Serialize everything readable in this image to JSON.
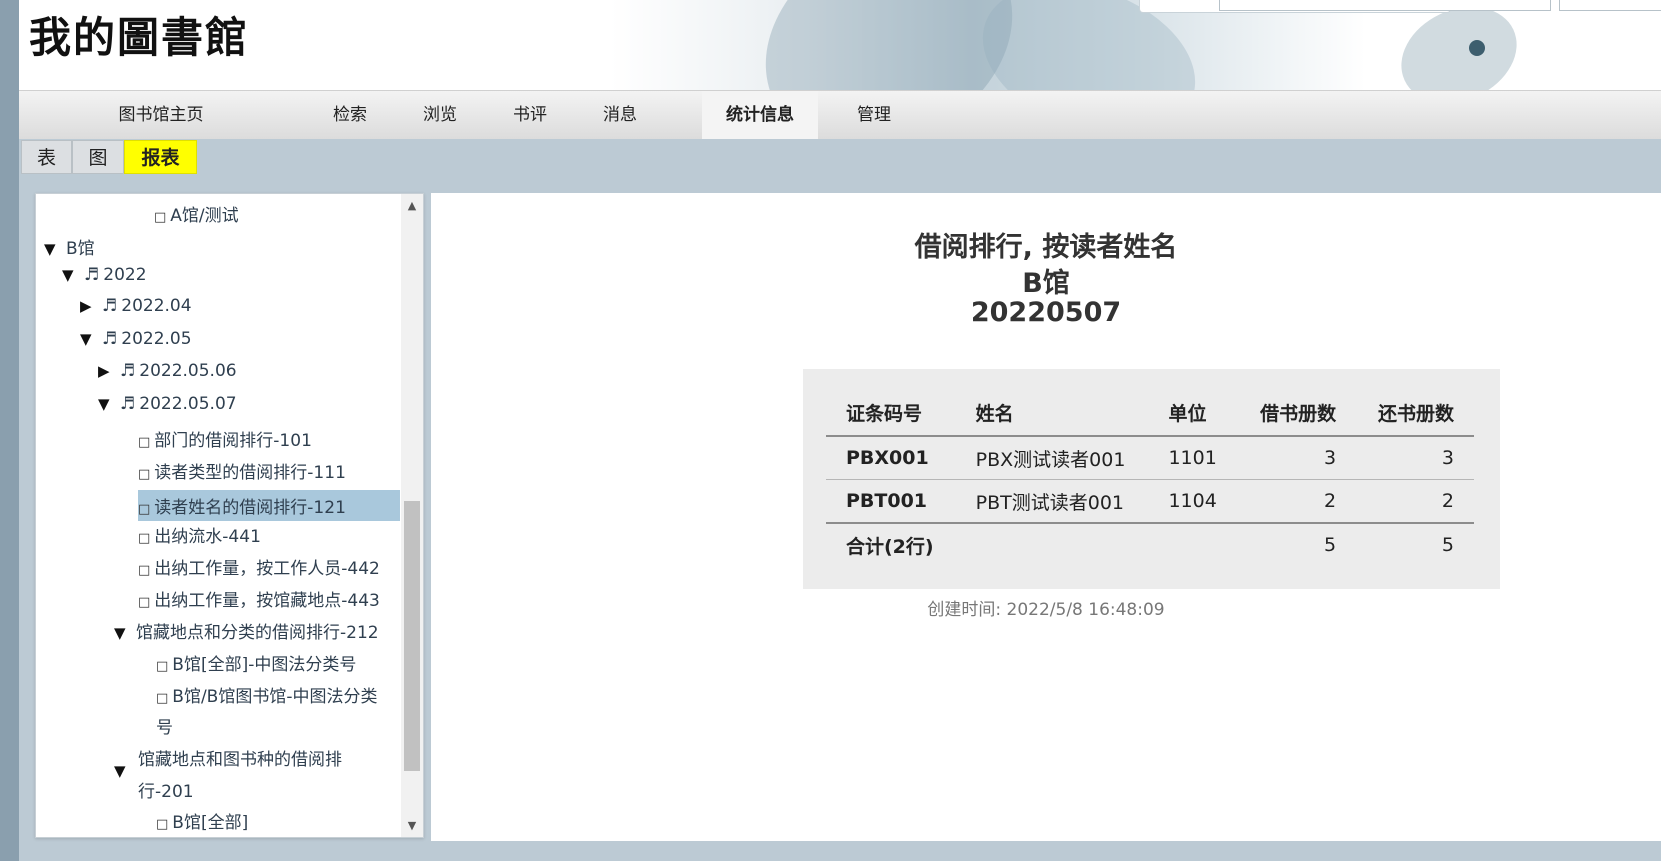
{
  "app": {
    "logo_text": "我的圖書館"
  },
  "nav": {
    "items": [
      {
        "label": "图书馆主页"
      },
      {
        "label": "检索"
      },
      {
        "label": "浏览"
      },
      {
        "label": "书评"
      },
      {
        "label": "消息"
      },
      {
        "label": "统计信息",
        "active": true
      },
      {
        "label": "管理"
      }
    ]
  },
  "subtabs": [
    {
      "label": "表"
    },
    {
      "label": "图"
    },
    {
      "label": "报表",
      "active": true
    }
  ],
  "tree": {
    "nodes": [
      {
        "toggle": "",
        "icon": "",
        "square": "□",
        "label": "A馆/测试"
      },
      {
        "toggle": "▼",
        "icon": "",
        "square": "",
        "label": "B馆"
      },
      {
        "toggle": "▼",
        "icon": "♬",
        "square": "",
        "label": "2022"
      },
      {
        "toggle": "▶",
        "icon": "♬",
        "square": "",
        "label": "2022.04"
      },
      {
        "toggle": "▼",
        "icon": "♬",
        "square": "",
        "label": "2022.05"
      },
      {
        "toggle": "▶",
        "icon": "♬",
        "square": "",
        "label": "2022.05.06"
      },
      {
        "toggle": "▼",
        "icon": "♬",
        "square": "",
        "label": "2022.05.07"
      },
      {
        "toggle": "",
        "icon": "",
        "square": "□",
        "label": "部门的借阅排行-101"
      },
      {
        "toggle": "",
        "icon": "",
        "square": "□",
        "label": "读者类型的借阅排行-111"
      },
      {
        "toggle": "",
        "icon": "",
        "square": "□",
        "label": "读者姓名的借阅排行-121",
        "selected": true
      },
      {
        "toggle": "",
        "icon": "",
        "square": "□",
        "label": "出纳流水-441"
      },
      {
        "toggle": "",
        "icon": "",
        "square": "□",
        "label": "出纳工作量，按工作人员-442"
      },
      {
        "toggle": "",
        "icon": "",
        "square": "□",
        "label": "出纳工作量，按馆藏地点-443"
      },
      {
        "toggle": "▼",
        "icon": "",
        "square": "",
        "label": "馆藏地点和分类的借阅排行-212"
      },
      {
        "toggle": "",
        "icon": "",
        "square": "□",
        "label": "B馆[全部]-中图法分类号"
      },
      {
        "toggle": "",
        "icon": "",
        "square": "□",
        "label": "B馆/B馆图书馆-中图法分类"
      },
      {
        "toggle": "",
        "icon": "",
        "square": "",
        "label": "号"
      },
      {
        "toggle": "▼",
        "icon": "",
        "square": "",
        "label": "馆藏地点和图书种的借阅排"
      },
      {
        "toggle": "",
        "icon": "",
        "square": "",
        "label": "行-201"
      },
      {
        "toggle": "",
        "icon": "",
        "square": "□",
        "label": "B馆[全部]"
      }
    ]
  },
  "report": {
    "title_line1": "借阅排行, 按读者姓名",
    "title_line2": "B馆",
    "title_line3": "20220507",
    "columns": [
      "证条码号",
      "姓名",
      "单位",
      "借书册数",
      "还书册数"
    ],
    "rows": [
      {
        "barcode": "PBX001",
        "name": "PBX测试读者001",
        "unit": "1101",
        "borrow": "3",
        "return": "3"
      },
      {
        "barcode": "PBT001",
        "name": "PBT测试读者001",
        "unit": "1104",
        "borrow": "2",
        "return": "2"
      }
    ],
    "total": {
      "label": "合计(2行)",
      "borrow": "5",
      "return": "5"
    },
    "created": "创建时间: 2022/5/8 16:48:09"
  },
  "icons": {
    "scroll_up": "▲",
    "scroll_down": "▼"
  }
}
